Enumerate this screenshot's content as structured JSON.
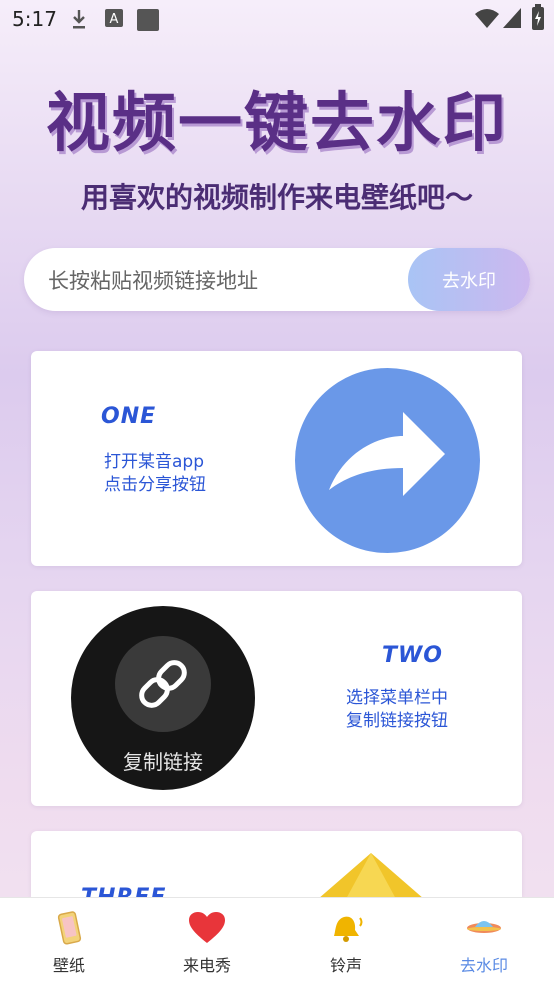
{
  "status_bar": {
    "time": "5:17",
    "icons": [
      "download-icon",
      "a-icon",
      "square-icon",
      "wifi-icon",
      "signal-icon",
      "battery-icon"
    ]
  },
  "header": {
    "title": "视频一键去水印",
    "subtitle": "用喜欢的视频制作来电壁纸吧～"
  },
  "url_input": {
    "placeholder": "长按粘贴视频链接地址",
    "value": ""
  },
  "action_button": {
    "label": "去水印"
  },
  "steps": [
    {
      "label": "ONE",
      "line1": "打开某音app",
      "line2": "点击分享按钮",
      "icon": "share-arrow-icon"
    },
    {
      "label": "TWO",
      "line1": "选择菜单栏中",
      "line2": "复制链接按钮",
      "icon": "link-icon",
      "circle_text": "复制链接"
    },
    {
      "label": "THREE",
      "icon": "yellow-diamond-icon"
    }
  ],
  "nav": [
    {
      "label": "壁纸",
      "icon": "wallpaper-icon",
      "active": false
    },
    {
      "label": "来电秀",
      "icon": "heart-icon",
      "active": false
    },
    {
      "label": "铃声",
      "icon": "bell-icon",
      "active": false
    },
    {
      "label": "去水印",
      "icon": "ufo-icon",
      "active": true
    }
  ],
  "colors": {
    "accent": "#5b8be4",
    "step_blue": "#2b56d6",
    "title_purple": "#5a2f86"
  }
}
